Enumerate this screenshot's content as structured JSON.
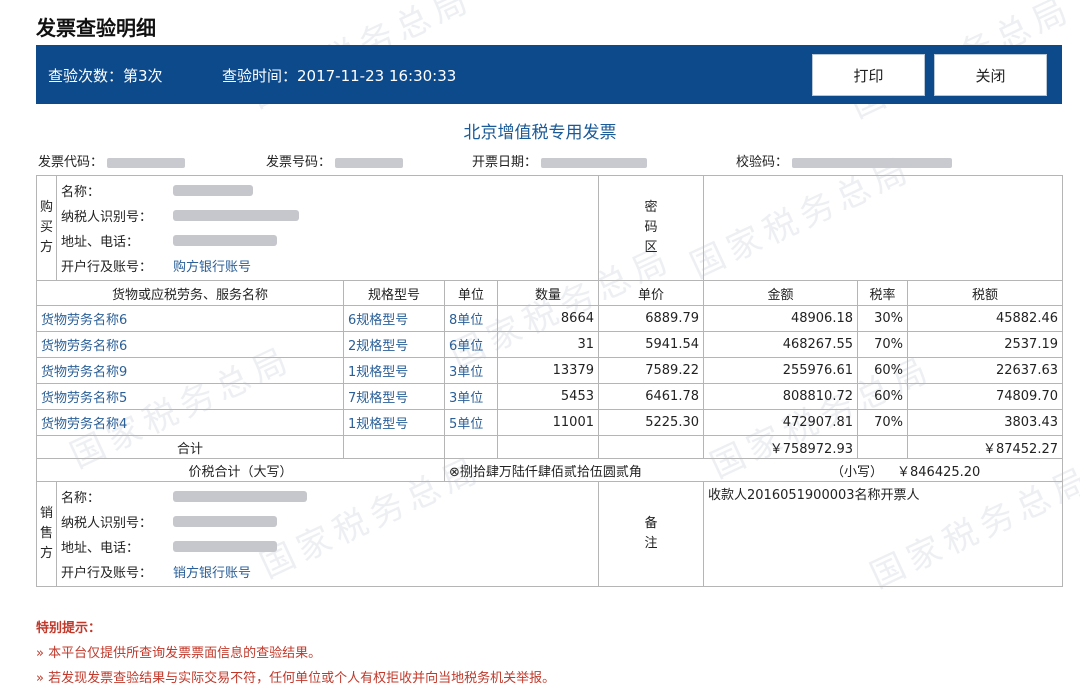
{
  "page_title": "发票查验明细",
  "topbar": {
    "check_count": "查验次数：第3次",
    "check_time": "查验时间：2017-11-23 16:30:33",
    "print_label": "打印",
    "close_label": "关闭",
    "bg_color": "#0d4a8c"
  },
  "invoice": {
    "title": "北京增值税专用发票",
    "meta": {
      "code_label": "发票代码：",
      "number_label": "发票号码：",
      "date_label": "开票日期：",
      "check_label": "校验码："
    },
    "buyer": {
      "side_label": [
        "购",
        "买",
        "方"
      ],
      "name_label": "名称：",
      "tax_id_label": "纳税人识别号：",
      "address_label": "地址、电话：",
      "bank_label": "开户行及账号：",
      "bank_value": "购方银行账号"
    },
    "cipher_label": [
      "密",
      "码",
      "区"
    ],
    "headers": [
      "货物或应税劳务、服务名称",
      "规格型号",
      "单位",
      "数量",
      "单价",
      "金额",
      "税率",
      "税额"
    ],
    "items": [
      {
        "name": "货物劳务名称6",
        "spec": "6规格型号",
        "unit": "8单位",
        "qty": "8664",
        "price": "6889.79",
        "amount": "48906.18",
        "rate": "30%",
        "tax": "45882.46"
      },
      {
        "name": "货物劳务名称6",
        "spec": "2规格型号",
        "unit": "6单位",
        "qty": "31",
        "price": "5941.54",
        "amount": "468267.55",
        "rate": "70%",
        "tax": "2537.19"
      },
      {
        "name": "货物劳务名称9",
        "spec": "1规格型号",
        "unit": "3单位",
        "qty": "13379",
        "price": "7589.22",
        "amount": "255976.61",
        "rate": "60%",
        "tax": "22637.63"
      },
      {
        "name": "货物劳务名称5",
        "spec": "7规格型号",
        "unit": "3单位",
        "qty": "5453",
        "price": "6461.78",
        "amount": "808810.72",
        "rate": "60%",
        "tax": "74809.70"
      },
      {
        "name": "货物劳务名称4",
        "spec": "1规格型号",
        "unit": "5单位",
        "qty": "11001",
        "price": "5225.30",
        "amount": "472907.81",
        "rate": "70%",
        "tax": "3803.43"
      }
    ],
    "total_label": "合计",
    "total_amount": "￥758972.93",
    "total_tax": "￥87452.27",
    "tax_total_label": "价税合计（大写）",
    "tax_total_upper": "⊗捌拾肆万陆仟肆佰贰拾伍圆贰角",
    "small_label": "（小写）",
    "tax_total_small": "￥846425.20",
    "seller": {
      "side_label": [
        "销",
        "售",
        "方"
      ],
      "name_label": "名称：",
      "tax_id_label": "纳税人识别号：",
      "address_label": "地址、电话：",
      "bank_label": "开户行及账号：",
      "bank_value": "销方银行账号"
    },
    "remark_label": [
      "备",
      "注"
    ],
    "remark_value": "收款人2016051900003名称开票人"
  },
  "notes": {
    "title": "特别提示：",
    "items": [
      "» 本平台仅提供所查询发票票面信息的查验结果。",
      "» 若发现发票查验结果与实际交易不符，任何单位或个人有权拒收并向当地税务机关举报。"
    ]
  },
  "watermark": "国家税务总局"
}
